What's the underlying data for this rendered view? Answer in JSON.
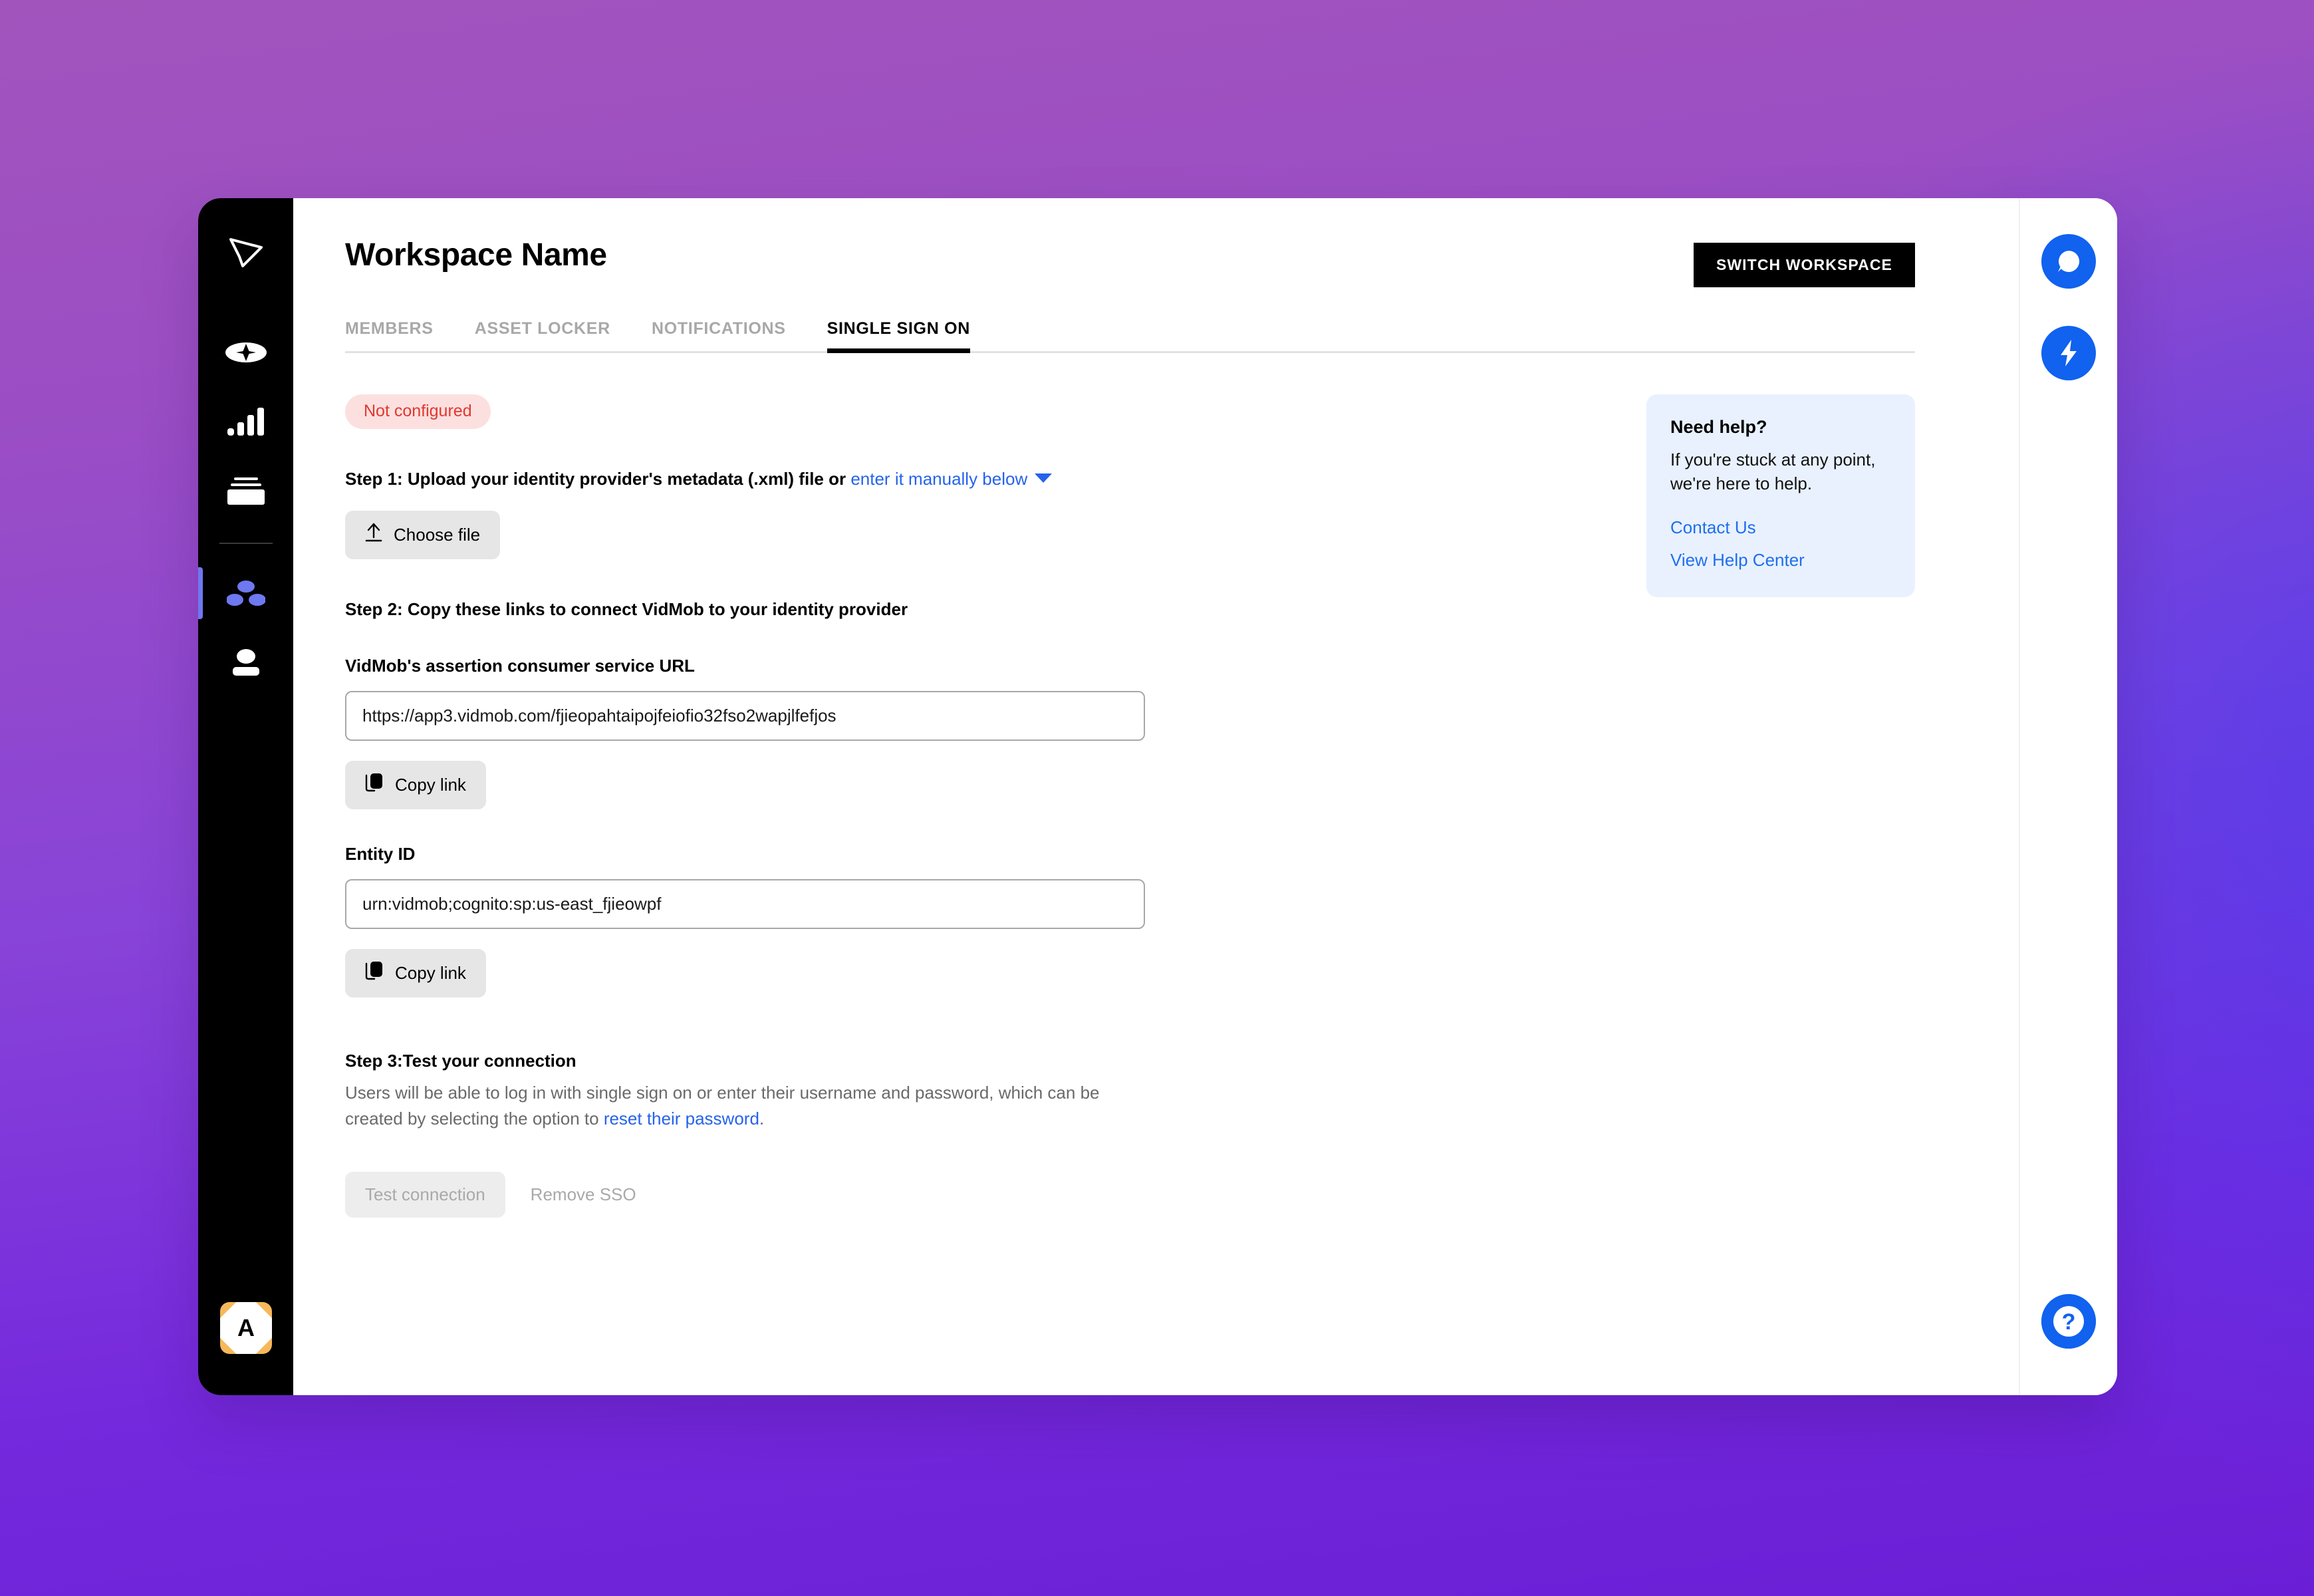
{
  "background": {
    "gradient_from": "#a254bd",
    "gradient_to": "#6a1fd6",
    "accent_blue_glow": "#463cf0"
  },
  "sidebar": {
    "logo_icon": "vidmob-cursor-logo-icon",
    "items": [
      {
        "icon": "sparkle-icon",
        "name": "sidebar-item-create",
        "active": false
      },
      {
        "icon": "bar-chart-icon",
        "name": "sidebar-item-analytics",
        "active": false
      },
      {
        "icon": "archive-box-icon",
        "name": "sidebar-item-library",
        "active": false
      },
      {
        "icon": "three-dots-triangle-icon",
        "name": "sidebar-item-workspace",
        "active": true
      },
      {
        "icon": "person-icon",
        "name": "sidebar-item-account",
        "active": false
      }
    ],
    "avatar": {
      "initial": "A",
      "bg_color": "#f7b85c"
    },
    "active_indicator_color": "#6e78f0"
  },
  "header": {
    "title": "Workspace Name",
    "switch_workspace_label": "SWITCH WORKSPACE"
  },
  "tabs": [
    {
      "label": "MEMBERS",
      "active": false
    },
    {
      "label": "ASSET LOCKER",
      "active": false
    },
    {
      "label": "NOTIFICATIONS",
      "active": false
    },
    {
      "label": "SINGLE SIGN ON",
      "active": true
    }
  ],
  "sso": {
    "status_badge": {
      "label": "Not configured",
      "text_color": "#e1382f",
      "bg_color": "#fce0df"
    },
    "step1": {
      "text_before": "Step 1: Upload your identity provider's metadata (.xml) file or ",
      "link_label": "enter it manually below",
      "caret_icon": "chevron-down-icon",
      "choose_file_label": "Choose file",
      "choose_file_icon": "upload-icon"
    },
    "step2": {
      "heading": "Step 2: Copy these links to connect VidMob to your identity provider",
      "acs_url_label": "VidMob's assertion consumer service URL",
      "acs_url_value": "https://app3.vidmob.com/fjieopahtaipojfeiofio32fso2wapjlfefjos",
      "acs_copy_label": "Copy link",
      "entity_id_label": "Entity ID",
      "entity_id_value": "urn:vidmob;cognito:sp:us-east_fjieowpf",
      "entity_copy_label": "Copy link",
      "copy_icon": "copy-icon"
    },
    "step3": {
      "heading": "Step 3:Test your connection",
      "body_before": "Users will be able to log in with single sign on or enter their username and password, which can be created by selecting the option to ",
      "body_link": "reset their password",
      "body_after": ".",
      "test_connection_label": "Test connection",
      "test_connection_disabled": true,
      "remove_sso_label": "Remove SSO"
    }
  },
  "help_card": {
    "title": "Need help?",
    "body": "If you're stuck at any point, we're here to help.",
    "link_contact": "Contact Us",
    "link_help_center": "View Help Center",
    "bg_color": "#e9f1fe",
    "link_color": "#1f6feb"
  },
  "widgets": {
    "chat_icon": "chat-bubble-icon",
    "bolt_icon": "lightning-bolt-icon",
    "help_icon": "question-mark-icon",
    "accent_color": "#1062ef"
  }
}
